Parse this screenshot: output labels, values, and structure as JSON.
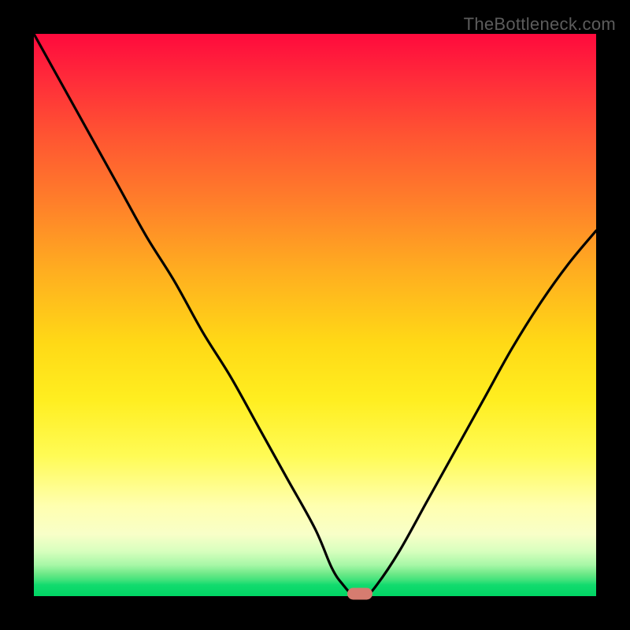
{
  "watermark": "TheBottleneck.com",
  "colors": {
    "background": "#000000",
    "curve": "#000000",
    "marker": "#d67c70",
    "gradient_top": "#ff0a3d",
    "gradient_bottom": "#00d564"
  },
  "chart_data": {
    "type": "line",
    "title": "",
    "xlabel": "",
    "ylabel": "",
    "xlim": [
      0,
      100
    ],
    "ylim": [
      0,
      100
    ],
    "grid": false,
    "series": [
      {
        "name": "bottleneck-curve",
        "x": [
          0,
          5,
          10,
          15,
          20,
          25,
          30,
          35,
          40,
          45,
          50,
          53,
          55,
          57,
          59,
          61,
          65,
          70,
          75,
          80,
          85,
          90,
          95,
          100
        ],
        "values": [
          100,
          91,
          82,
          73,
          64,
          56,
          47,
          39,
          30,
          21,
          12,
          5,
          2,
          0,
          0,
          2,
          8,
          17,
          26,
          35,
          44,
          52,
          59,
          65
        ]
      }
    ],
    "annotations": [
      {
        "name": "optimal-marker",
        "x": 58,
        "y": 0
      }
    ]
  }
}
